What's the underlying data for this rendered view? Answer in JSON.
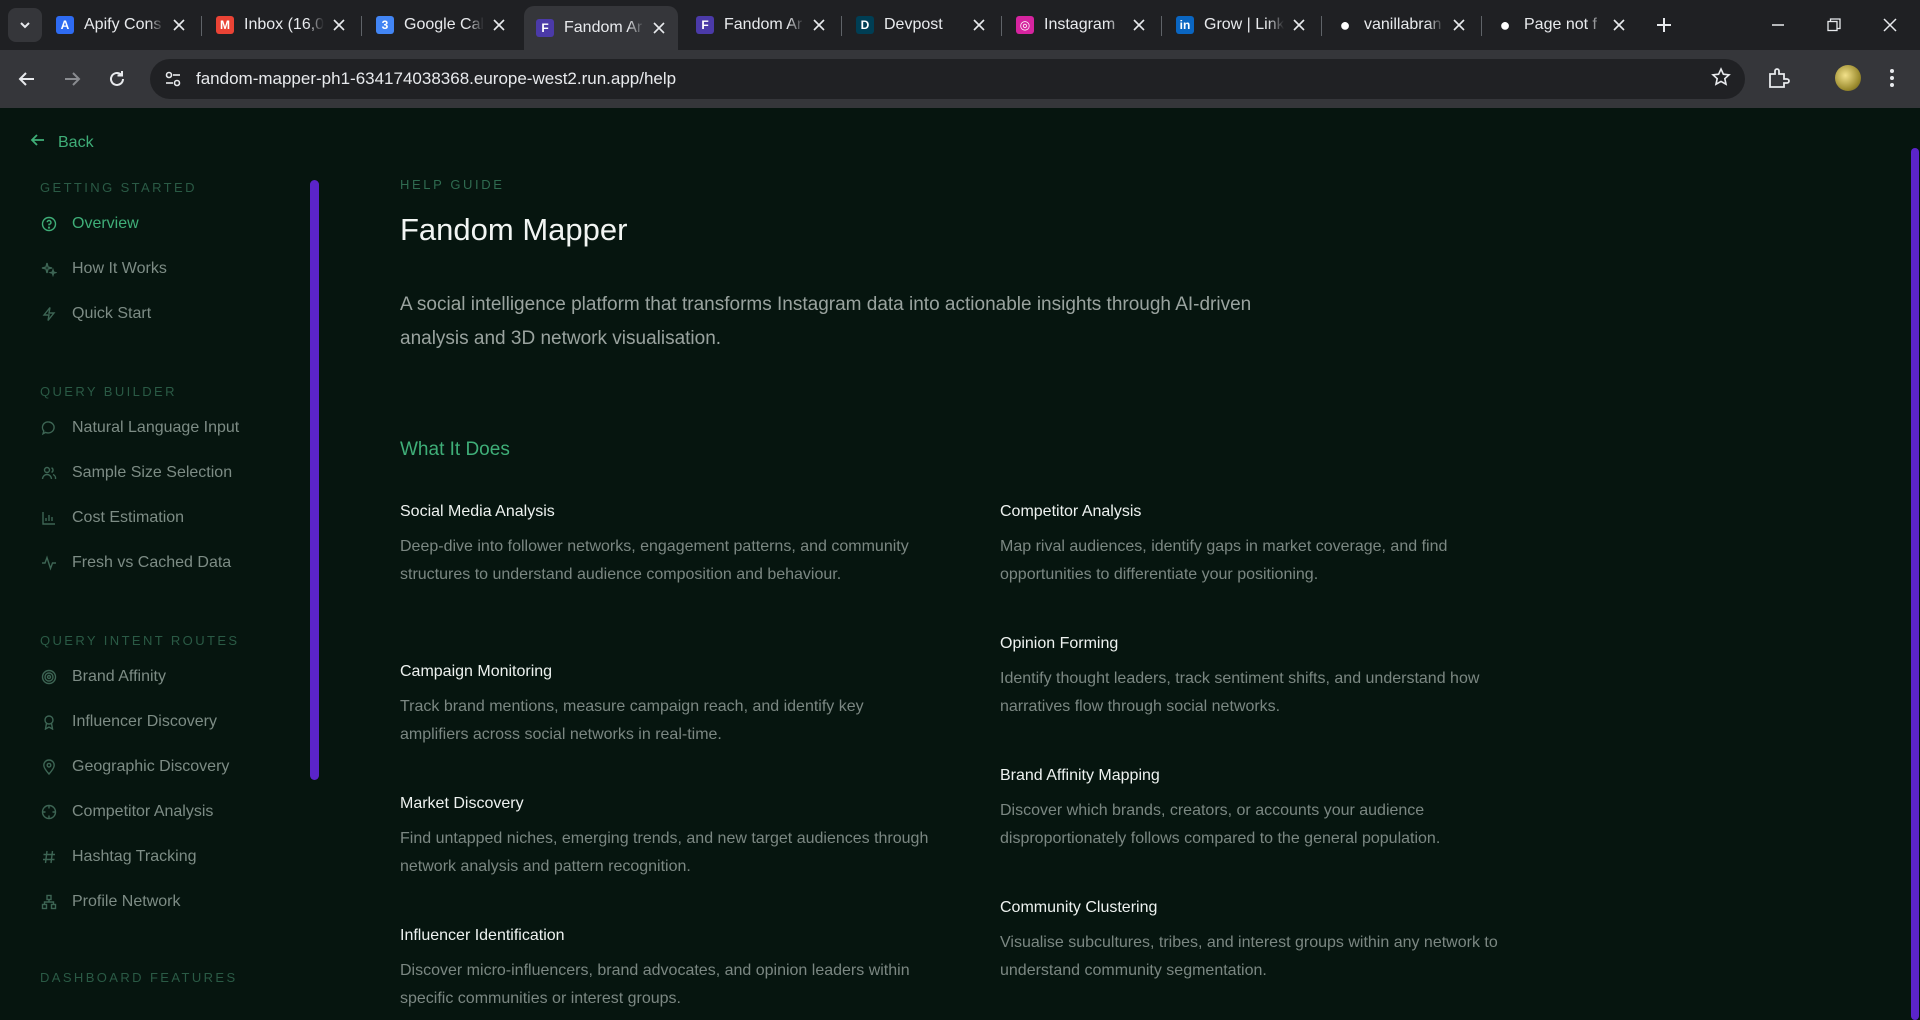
{
  "browser": {
    "tabs": [
      {
        "title": "Apify Cons",
        "icon": "apify-icon",
        "color": "#2e6bf2"
      },
      {
        "title": "Inbox (16,0",
        "icon": "gmail-icon",
        "color": "#ea4335"
      },
      {
        "title": "Google Cal",
        "icon": "google-calendar-icon",
        "color": "#4285f4"
      },
      {
        "title": "Fandom Ar",
        "icon": "fandom-mapper-icon",
        "color": "#4b3aa8"
      },
      {
        "title": "Fandom Ar",
        "icon": "fandom-mapper-icon",
        "color": "#4b3aa8"
      },
      {
        "title": "Devpost",
        "icon": "devpost-icon",
        "color": "#003e54"
      },
      {
        "title": "Instagram",
        "icon": "instagram-icon",
        "color": "#d6249f"
      },
      {
        "title": "Grow | Link",
        "icon": "linkedin-icon",
        "color": "#0a66c2"
      },
      {
        "title": "vanillabran",
        "icon": "github-icon",
        "color": "#ffffff"
      },
      {
        "title": "Page not f",
        "icon": "github-icon",
        "color": "#ffffff"
      }
    ],
    "active_tab_index": 3,
    "url": "fandom-mapper-ph1-634174038368.europe-west2.run.app/help"
  },
  "page": {
    "back_label": "Back",
    "sidebar": {
      "sections": [
        {
          "heading": "GETTING STARTED",
          "items": [
            {
              "label": "Overview",
              "icon": "help-circle-icon",
              "active": true
            },
            {
              "label": "How It Works",
              "icon": "sparkles-icon",
              "active": false
            },
            {
              "label": "Quick Start",
              "icon": "lightning-icon",
              "active": false
            }
          ]
        },
        {
          "heading": "QUERY BUILDER",
          "items": [
            {
              "label": "Natural Language Input",
              "icon": "chat-bubble-icon",
              "active": false
            },
            {
              "label": "Sample Size Selection",
              "icon": "users-icon",
              "active": false
            },
            {
              "label": "Cost Estimation",
              "icon": "bar-chart-icon",
              "active": false
            },
            {
              "label": "Fresh vs Cached Data",
              "icon": "activity-icon",
              "active": false
            }
          ]
        },
        {
          "heading": "QUERY INTENT ROUTES",
          "items": [
            {
              "label": "Brand Affinity",
              "icon": "target-icon",
              "active": false
            },
            {
              "label": "Influencer Discovery",
              "icon": "award-icon",
              "active": false
            },
            {
              "label": "Geographic Discovery",
              "icon": "map-pin-icon",
              "active": false
            },
            {
              "label": "Competitor Analysis",
              "icon": "crosshair-icon",
              "active": false
            },
            {
              "label": "Hashtag Tracking",
              "icon": "hash-icon",
              "active": false
            },
            {
              "label": "Profile Network",
              "icon": "network-icon",
              "active": false
            }
          ]
        },
        {
          "heading": "DASHBOARD FEATURES",
          "items": []
        }
      ]
    },
    "main": {
      "eyebrow": "HELP GUIDE",
      "title": "Fandom Mapper",
      "lead": "A social intelligence platform that transforms Instagram data into actionable insights through AI-driven analysis and 3D network visualisation.",
      "section_title": "What It Does",
      "features_left": [
        {
          "title": "Social Media Analysis",
          "desc": "Deep-dive into follower networks, engagement patterns, and community structures to understand audience composition and behaviour."
        },
        {
          "title": "Campaign Monitoring",
          "desc": "Track brand mentions, measure campaign reach, and identify key amplifiers across social networks in real-time."
        },
        {
          "title": "Market Discovery",
          "desc": "Find untapped niches, emerging trends, and new target audiences through network analysis and pattern recognition."
        },
        {
          "title": "Influencer Identification",
          "desc": "Discover micro-influencers, brand advocates, and opinion leaders within specific communities or interest groups."
        }
      ],
      "features_right": [
        {
          "title": "Competitor Analysis",
          "desc": "Map rival audiences, identify gaps in market coverage, and find opportunities to differentiate your positioning."
        },
        {
          "title": "Opinion Forming",
          "desc": "Identify thought leaders, track sentiment shifts, and understand how narratives flow through social networks."
        },
        {
          "title": "Brand Affinity Mapping",
          "desc": "Discover which brands, creators, or accounts your audience disproportionately follows compared to the general population."
        },
        {
          "title": "Community Clustering",
          "desc": "Visualise subcultures, tribes, and interest groups within any network to understand community segmentation."
        }
      ]
    }
  }
}
